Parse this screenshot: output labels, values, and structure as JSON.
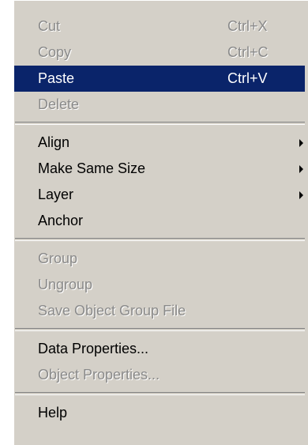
{
  "menu": {
    "cut": {
      "label": "Cut",
      "shortcut": "Ctrl+X"
    },
    "copy": {
      "label": "Copy",
      "shortcut": "Ctrl+C"
    },
    "paste": {
      "label": "Paste",
      "shortcut": "Ctrl+V"
    },
    "delete": {
      "label": "Delete"
    },
    "align": {
      "label": "Align"
    },
    "make_same_size": {
      "label": "Make Same Size"
    },
    "layer": {
      "label": "Layer"
    },
    "anchor": {
      "label": "Anchor"
    },
    "group": {
      "label": "Group"
    },
    "ungroup": {
      "label": "Ungroup"
    },
    "save_object_group_file": {
      "label": "Save Object Group File"
    },
    "data_properties": {
      "label": "Data Properties..."
    },
    "object_properties": {
      "label": "Object Properties..."
    },
    "help": {
      "label": "Help"
    }
  },
  "colors": {
    "menu_background": "#d4d0c8",
    "highlight": "#0a246a",
    "highlight_text": "#ffffff",
    "disabled_text": "#8a8a8a"
  },
  "icons": {
    "submenu": "chevron-right-icon"
  }
}
